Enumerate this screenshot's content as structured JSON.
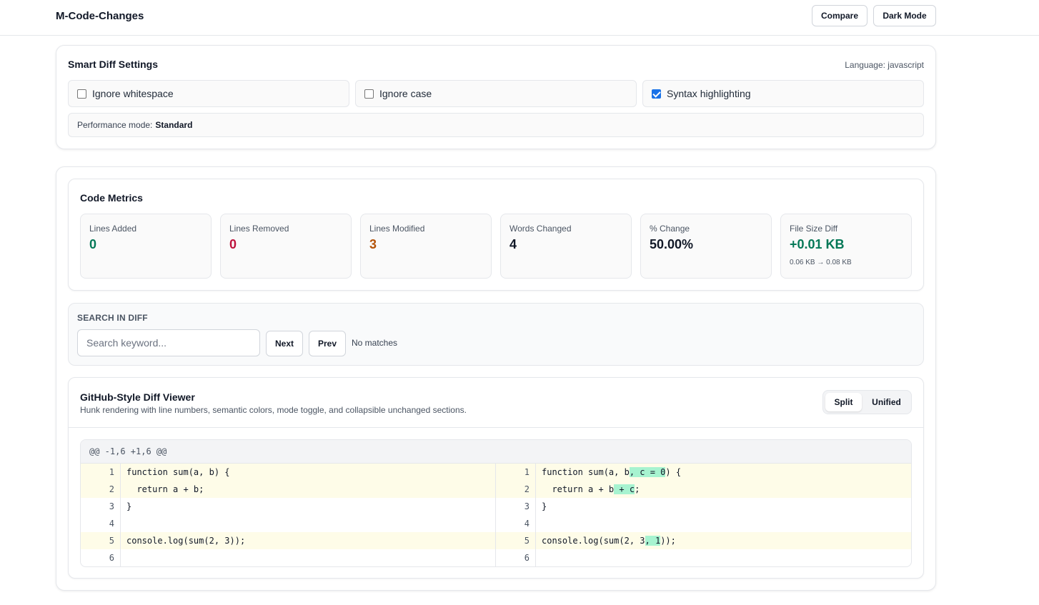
{
  "app": {
    "title": "M-Code-Changes",
    "compare_label": "Compare",
    "dark_mode_label": "Dark Mode"
  },
  "settings": {
    "title": "Smart Diff Settings",
    "language": "Language: javascript",
    "options": [
      {
        "label": "Ignore whitespace",
        "checked": false
      },
      {
        "label": "Ignore case",
        "checked": false
      },
      {
        "label": "Syntax highlighting",
        "checked": true
      }
    ],
    "performance_label": "Performance mode:",
    "performance_value": "Standard"
  },
  "metrics": {
    "title": "Code Metrics",
    "items": [
      {
        "label": "Lines Added",
        "value": "0",
        "color": "#047857"
      },
      {
        "label": "Lines Removed",
        "value": "0",
        "color": "#be123c"
      },
      {
        "label": "Lines Modified",
        "value": "3",
        "color": "#b45309"
      },
      {
        "label": "Words Changed",
        "value": "4",
        "color": "#111827"
      },
      {
        "label": "% Change",
        "value": "50.00%",
        "color": "#111827"
      },
      {
        "label": "File Size Diff",
        "value": "+0.01 KB",
        "color": "#047857",
        "sub": "0.06 KB → 0.08 KB"
      }
    ]
  },
  "search": {
    "title": "SEARCH IN DIFF",
    "placeholder": "Search keyword...",
    "next_label": "Next",
    "prev_label": "Prev",
    "status": "No matches"
  },
  "viewer": {
    "title": "GitHub-Style Diff Viewer",
    "description": "Hunk rendering with line numbers, semantic colors, mode toggle, and collapsible unchanged sections.",
    "modes": [
      "Split",
      "Unified"
    ],
    "active_mode": "Split",
    "hunk_header": "@@ -1,6 +1,6 @@",
    "left_lines": [
      {
        "num": "1",
        "modified": true,
        "parts": [
          {
            "t": "function sum(a, b) {"
          }
        ]
      },
      {
        "num": "2",
        "modified": true,
        "parts": [
          {
            "t": "  return a + b;"
          }
        ]
      },
      {
        "num": "3",
        "modified": false,
        "parts": [
          {
            "t": "}"
          }
        ]
      },
      {
        "num": "4",
        "modified": false,
        "parts": [
          {
            "t": ""
          }
        ]
      },
      {
        "num": "5",
        "modified": true,
        "parts": [
          {
            "t": "console.log(sum(2, 3));"
          }
        ]
      },
      {
        "num": "6",
        "modified": false,
        "parts": [
          {
            "t": ""
          }
        ]
      }
    ],
    "right_lines": [
      {
        "num": "1",
        "modified": true,
        "parts": [
          {
            "t": "function sum(a, b"
          },
          {
            "t": ", c = 0",
            "hl": true
          },
          {
            "t": ") {"
          }
        ]
      },
      {
        "num": "2",
        "modified": true,
        "parts": [
          {
            "t": "  return a + b"
          },
          {
            "t": " + c",
            "hl": true
          },
          {
            "t": ";"
          }
        ]
      },
      {
        "num": "3",
        "modified": false,
        "parts": [
          {
            "t": "}"
          }
        ]
      },
      {
        "num": "4",
        "modified": false,
        "parts": [
          {
            "t": ""
          }
        ]
      },
      {
        "num": "5",
        "modified": true,
        "parts": [
          {
            "t": "console.log(sum(2, 3"
          },
          {
            "t": ", 1",
            "hl": true
          },
          {
            "t": "));"
          }
        ]
      },
      {
        "num": "6",
        "modified": false,
        "parts": [
          {
            "t": ""
          }
        ]
      }
    ]
  }
}
